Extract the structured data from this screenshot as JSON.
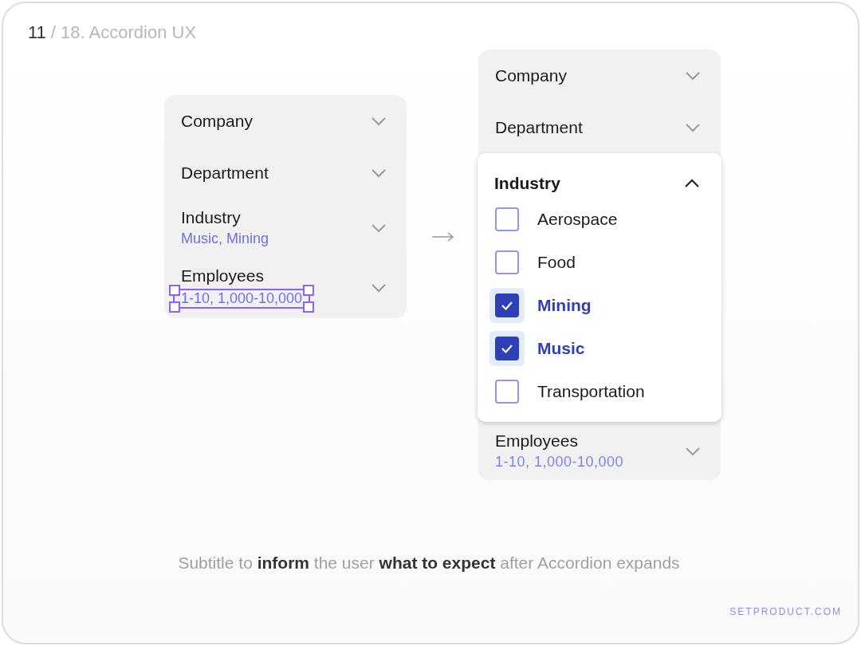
{
  "slide": {
    "number": "11",
    "title": "/ 18. Accordion UX"
  },
  "collapsed_accordion": {
    "items": [
      {
        "label": "Company",
        "expanded": false,
        "selected": false
      },
      {
        "label": "Department",
        "expanded": false,
        "selected": false
      },
      {
        "label": "Industry",
        "summary": "Music, Mining",
        "expanded": false,
        "selected": false
      },
      {
        "label": "Employees",
        "summary": "1-10, 1,000-10,000",
        "expanded": false,
        "selected": true
      }
    ]
  },
  "expanded_accordion": {
    "items": [
      {
        "label": "Company",
        "expanded": false
      },
      {
        "label": "Department",
        "expanded": false
      },
      {
        "label": "Industry",
        "expanded": true,
        "options": [
          {
            "label": "Aerospace",
            "checked": false
          },
          {
            "label": "Food",
            "checked": false
          },
          {
            "label": "Mining",
            "checked": true
          },
          {
            "label": "Music",
            "checked": true
          },
          {
            "label": "Transportation",
            "checked": false
          }
        ]
      },
      {
        "label": "Employees",
        "summary": "1-10, 1,000-10,000",
        "expanded": false
      }
    ]
  },
  "caption": "Subtitle to **inform** the user **what to expect** after Accordion expands",
  "footer_link": "SETPRODUCT.COM"
}
